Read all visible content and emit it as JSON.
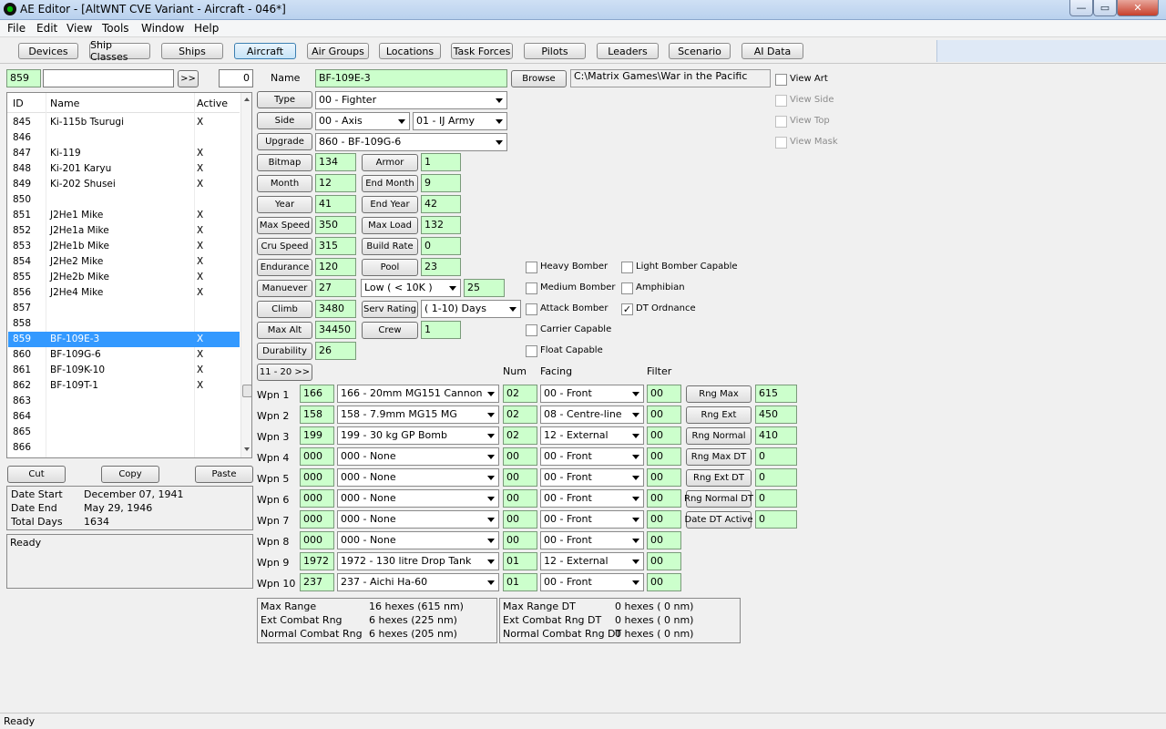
{
  "window": {
    "title": "AE Editor - [AltWNT CVE Variant - Aircraft - 046*]",
    "app_icon": "app-icon",
    "min": "—",
    "max": "▭",
    "close": "✕"
  },
  "menu": [
    "File",
    "Edit",
    "View",
    "Tools",
    "Window",
    "Help"
  ],
  "toolbar": [
    "Devices",
    "Ship Classes",
    "Ships",
    "Aircraft",
    "Air Groups",
    "Locations",
    "Task Forces",
    "Pilots",
    "Leaders",
    "Scenario",
    "AI Data"
  ],
  "search": {
    "id": "859",
    "text": "",
    "go": ">>",
    "count": "0"
  },
  "list": {
    "headers": {
      "id": "ID",
      "name": "Name",
      "active": "Active"
    },
    "rows": [
      {
        "id": "845",
        "name": "Ki-115b Tsurugi",
        "active": "X"
      },
      {
        "id": "846",
        "name": "",
        "active": ""
      },
      {
        "id": "847",
        "name": "Ki-119",
        "active": "X"
      },
      {
        "id": "848",
        "name": "Ki-201 Karyu",
        "active": "X"
      },
      {
        "id": "849",
        "name": "Ki-202 Shusei",
        "active": "X"
      },
      {
        "id": "850",
        "name": "",
        "active": ""
      },
      {
        "id": "851",
        "name": "J2He1 Mike",
        "active": "X"
      },
      {
        "id": "852",
        "name": "J2He1a Mike",
        "active": "X"
      },
      {
        "id": "853",
        "name": "J2He1b Mike",
        "active": "X"
      },
      {
        "id": "854",
        "name": "J2He2 Mike",
        "active": "X"
      },
      {
        "id": "855",
        "name": "J2He2b Mike",
        "active": "X"
      },
      {
        "id": "856",
        "name": "J2He4 Mike",
        "active": "X"
      },
      {
        "id": "857",
        "name": "",
        "active": ""
      },
      {
        "id": "858",
        "name": "",
        "active": ""
      },
      {
        "id": "859",
        "name": "BF-109E-3",
        "active": "X"
      },
      {
        "id": "860",
        "name": "BF-109G-6",
        "active": "X"
      },
      {
        "id": "861",
        "name": "BF-109K-10",
        "active": "X"
      },
      {
        "id": "862",
        "name": "BF-109T-1",
        "active": "X"
      },
      {
        "id": "863",
        "name": "",
        "active": ""
      },
      {
        "id": "864",
        "name": "",
        "active": ""
      },
      {
        "id": "865",
        "name": "",
        "active": ""
      },
      {
        "id": "866",
        "name": "",
        "active": ""
      }
    ],
    "selected_index": 14
  },
  "edit_buttons": {
    "cut": "Cut",
    "copy": "Copy",
    "paste": "Paste"
  },
  "dates": {
    "start_label": "Date Start",
    "start": "December 07, 1941",
    "end_label": "Date End",
    "end": "May 29, 1946",
    "days_label": "Total Days",
    "days": "1634"
  },
  "log": "Ready",
  "form": {
    "name_label": "Name",
    "name": "BF-109E-3",
    "browse": "Browse",
    "art_path": "C:\\Matrix Games\\War in the Pacific",
    "type_btn": "Type",
    "type": "00 - Fighter",
    "side_btn": "Side",
    "side": "00 - Axis",
    "service": "01 - IJ Army",
    "upgrade_btn": "Upgrade",
    "upgrade": "860 - BF-109G-6",
    "bitmap_btn": "Bitmap",
    "bitmap": "134",
    "armor_btn": "Armor",
    "armor": "1",
    "month_btn": "Month",
    "month": "12",
    "end_month_btn": "End Month",
    "end_month": "9",
    "year_btn": "Year",
    "year": "41",
    "end_year_btn": "End Year",
    "end_year": "42",
    "max_speed_btn": "Max Speed",
    "max_speed": "350",
    "max_load_btn": "Max Load",
    "max_load": "132",
    "cru_speed_btn": "Cru Speed",
    "cru_speed": "315",
    "build_rate_btn": "Build Rate",
    "build_rate": "0",
    "endurance_btn": "Endurance",
    "endurance": "120",
    "pool_btn": "Pool",
    "pool": "23",
    "maneuver_btn": "Manuever",
    "maneuver": "27",
    "altitude_band": "Low    ( < 10K )",
    "altitude_value": "25",
    "climb_btn": "Climb",
    "climb": "3480",
    "serv_rating_btn": "Serv Rating",
    "serv_rating": "( 1-10)  Days",
    "max_alt_btn": "Max Alt",
    "max_alt": "34450",
    "crew_btn": "Crew",
    "crew": "1",
    "durability_btn": "Durability",
    "durability": "26",
    "page_btn": "11 - 20 >>"
  },
  "view_checks": [
    {
      "label": "View Art",
      "checked": false,
      "enabled": true
    },
    {
      "label": "View Side",
      "checked": false,
      "enabled": false
    },
    {
      "label": "View Top",
      "checked": false,
      "enabled": false
    },
    {
      "label": "View Mask",
      "checked": false,
      "enabled": false
    }
  ],
  "capabilities_left": [
    {
      "label": "Heavy Bomber",
      "checked": false
    },
    {
      "label": "Medium Bomber",
      "checked": false
    },
    {
      "label": "Attack Bomber",
      "checked": false
    },
    {
      "label": "Carrier Capable",
      "checked": false
    },
    {
      "label": "Float Capable",
      "checked": false
    }
  ],
  "capabilities_right": [
    {
      "label": "Light Bomber Capable",
      "checked": false
    },
    {
      "label": "Amphibian",
      "checked": false
    },
    {
      "label": "DT Ordnance",
      "checked": true
    }
  ],
  "weapons_headers": {
    "num": "Num",
    "facing": "Facing",
    "filter": "Filter"
  },
  "weapons": [
    {
      "label": "Wpn 1",
      "code": "166",
      "device": "166 - 20mm MG151 Cannon",
      "num": "02",
      "facing": "00 - Front",
      "filter": "00"
    },
    {
      "label": "Wpn 2",
      "code": "158",
      "device": "158 - 7.9mm MG15 MG",
      "num": "02",
      "facing": "08 - Centre-line",
      "filter": "00"
    },
    {
      "label": "Wpn 3",
      "code": "199",
      "device": "199 - 30 kg GP Bomb",
      "num": "02",
      "facing": "12 - External",
      "filter": "00"
    },
    {
      "label": "Wpn 4",
      "code": "000",
      "device": "000 - None",
      "num": "00",
      "facing": "00 - Front",
      "filter": "00"
    },
    {
      "label": "Wpn 5",
      "code": "000",
      "device": "000 - None",
      "num": "00",
      "facing": "00 - Front",
      "filter": "00"
    },
    {
      "label": "Wpn 6",
      "code": "000",
      "device": "000 - None",
      "num": "00",
      "facing": "00 - Front",
      "filter": "00"
    },
    {
      "label": "Wpn 7",
      "code": "000",
      "device": "000 - None",
      "num": "00",
      "facing": "00 - Front",
      "filter": "00"
    },
    {
      "label": "Wpn 8",
      "code": "000",
      "device": "000 - None",
      "num": "00",
      "facing": "00 - Front",
      "filter": "00"
    },
    {
      "label": "Wpn 9",
      "code": "1972",
      "device": "1972 - 130 litre Drop Tank",
      "num": "01",
      "facing": "12 - External",
      "filter": "00"
    },
    {
      "label": "Wpn 10",
      "code": "237",
      "device": "237 - Aichi Ha-60",
      "num": "01",
      "facing": "00 - Front",
      "filter": "00"
    }
  ],
  "ranges": [
    {
      "btn": "Rng Max",
      "value": "615"
    },
    {
      "btn": "Rng Ext",
      "value": "450"
    },
    {
      "btn": "Rng Normal",
      "value": "410"
    },
    {
      "btn": "Rng Max DT",
      "value": "0"
    },
    {
      "btn": "Rng Ext DT",
      "value": "0"
    },
    {
      "btn": "Rng Normal DT",
      "value": "0"
    },
    {
      "btn": "Date DT Active",
      "value": "0"
    }
  ],
  "summary_left": [
    {
      "label": "Max Range",
      "value": "16 hexes (615 nm)"
    },
    {
      "label": "Ext Combat Rng",
      "value": "6 hexes (225 nm)"
    },
    {
      "label": "Normal Combat Rng",
      "value": "6 hexes (205 nm)"
    }
  ],
  "summary_right": [
    {
      "label": "Max Range DT",
      "value": "0 hexes ( 0 nm)"
    },
    {
      "label": "Ext Combat Rng DT",
      "value": "0 hexes ( 0 nm)"
    },
    {
      "label": "Normal Combat Rng DT",
      "value": "0 hexes ( 0 nm)"
    }
  ],
  "status": "Ready",
  "colors": {
    "field_bg": "#ccffcc",
    "selection": "#3399ff"
  }
}
